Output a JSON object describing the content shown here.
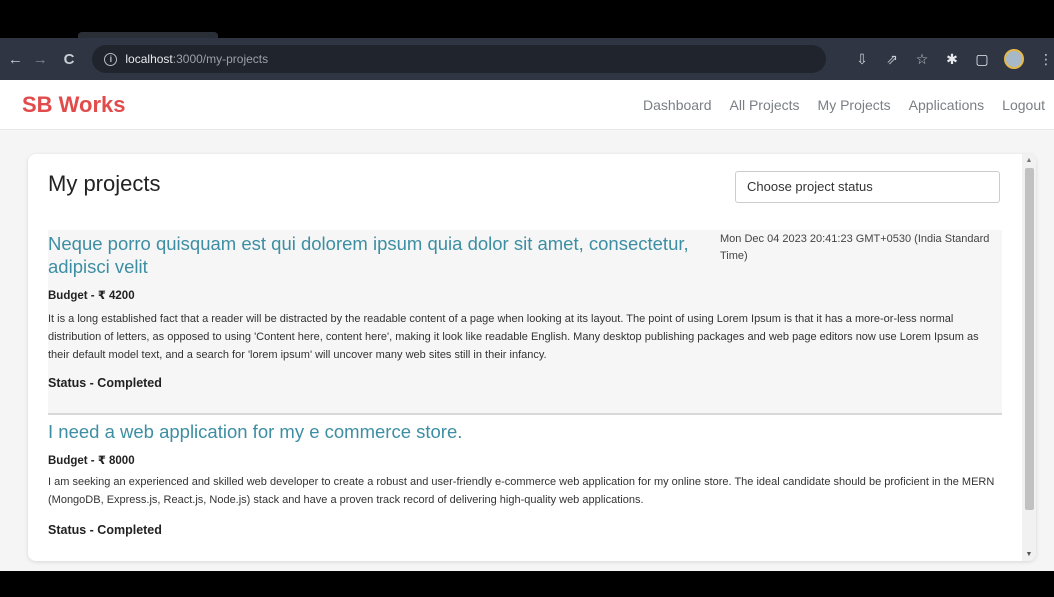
{
  "browser": {
    "url_host": "localhost",
    "url_path": ":3000/my-projects",
    "icons": [
      "install-icon",
      "share-icon",
      "star-icon",
      "extensions-icon",
      "sidebar-icon",
      "profile-avatar",
      "menu-icon"
    ]
  },
  "navbar": {
    "brand": "SB Works",
    "brand_color": "#e24b4b",
    "links": [
      "Dashboard",
      "All Projects",
      "My Projects",
      "Applications",
      "Logout"
    ]
  },
  "main": {
    "title": "My projects",
    "status_select": {
      "placeholder": "Choose project status"
    },
    "projects": [
      {
        "title": "Neque porro quisquam est qui dolorem ipsum quia dolor sit amet, consectetur, adipisci velit",
        "date": "Mon Dec 04 2023 20:41:23 GMT+0530 (India Standard Time)",
        "budget": "Budget - ₹ 4200",
        "description": "It is a long established fact that a reader will be distracted by the readable content of a page when looking at its layout. The point of using Lorem Ipsum is that it has a more-or-less normal distribution of letters, as opposed to using 'Content here, content here', making it look like readable English. Many desktop publishing packages and web page editors now use Lorem Ipsum as their default model text, and a search for 'lorem ipsum' will uncover many web sites still in their infancy.",
        "status": "Status - Completed"
      },
      {
        "title": "I need a web application for my e commerce store.",
        "date": "",
        "budget": "Budget - ₹ 8000",
        "description": "I am seeking an experienced and skilled web developer to create a robust and user-friendly e-commerce web application for my online store. The ideal candidate should be proficient in the MERN (MongoDB, Express.js, React.js, Node.js) stack and have a proven track record of delivering high-quality web applications.",
        "status": "Status - Completed"
      }
    ]
  },
  "colors": {
    "accent_title": "#3d8ea3",
    "chrome_bg": "#2f3542"
  }
}
